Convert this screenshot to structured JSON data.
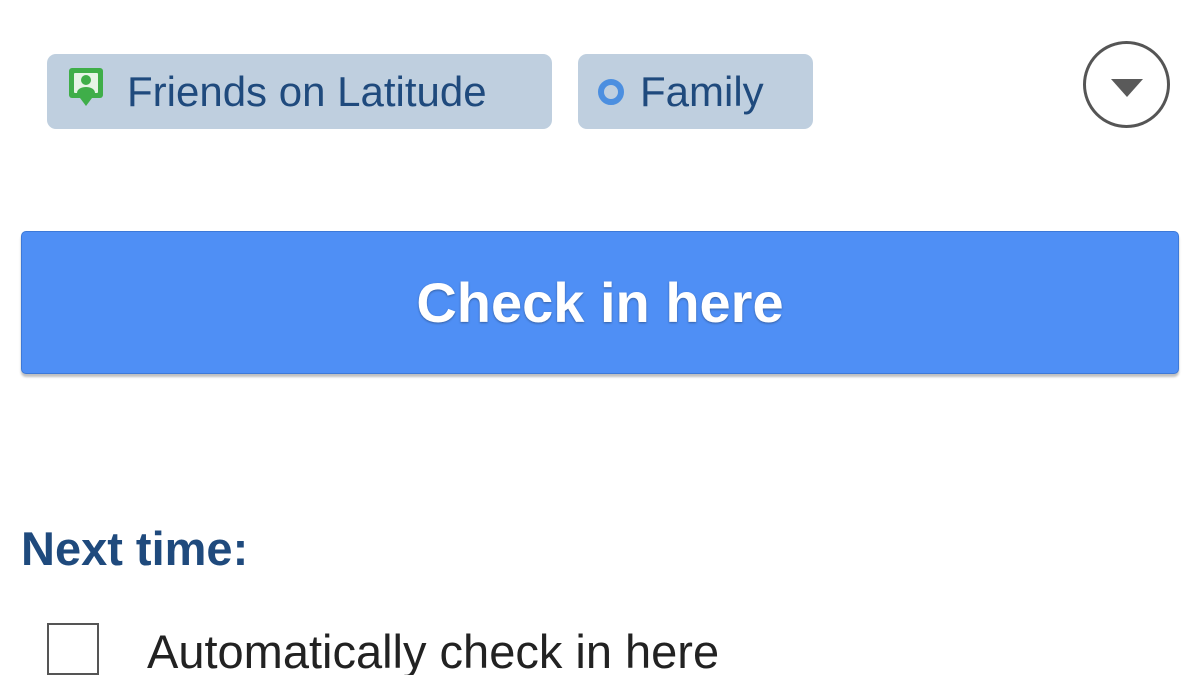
{
  "sharing": {
    "chips": [
      {
        "label": "Friends on Latitude",
        "icon": "latitude-person-pin-icon"
      },
      {
        "label": "Family",
        "icon": "circle-outline-icon"
      }
    ],
    "dropdown_icon": "chevron-down-icon"
  },
  "primary_action": {
    "label": "Check in here"
  },
  "next_time": {
    "heading": "Next time:",
    "auto_checkin": {
      "label": "Automatically check in here",
      "checked": false
    }
  },
  "colors": {
    "chip_background": "#bfcfdf",
    "chip_text": "#1f4a7d",
    "latitude_green": "#3fae49",
    "family_ring": "#4c8fe0",
    "button_blue": "#4f8ff5",
    "heading_blue": "#1f4a7d"
  }
}
